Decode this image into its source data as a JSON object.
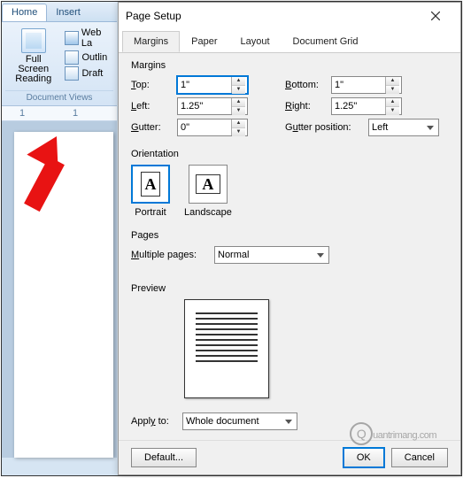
{
  "ribbon": {
    "tabs": [
      "Home",
      "Insert"
    ],
    "items": {
      "webLayout": "Web La",
      "outline": "Outlin",
      "draft": "Draft",
      "fullScreen": "Full Screen\nReading"
    },
    "group": "Document Views"
  },
  "dialog": {
    "title": "Page Setup",
    "tabs": [
      "Margins",
      "Paper",
      "Layout",
      "Document Grid"
    ],
    "margins": {
      "legend": "Margins",
      "topLabel": "Top:",
      "topValue": "1\"",
      "bottomLabel": "Bottom:",
      "bottomValue": "1\"",
      "leftLabel": "Left:",
      "leftValue": "1.25\"",
      "rightLabel": "Right:",
      "rightValue": "1.25\"",
      "gutterLabel": "Gutter:",
      "gutterValue": "0\"",
      "gutterPosLabel": "Gutter position:",
      "gutterPosValue": "Left"
    },
    "orientation": {
      "legend": "Orientation",
      "portrait": "Portrait",
      "landscape": "Landscape",
      "glyph": "A"
    },
    "pages": {
      "legend": "Pages",
      "multiLabel": "Multiple pages:",
      "multiValue": "Normal"
    },
    "preview": {
      "legend": "Preview"
    },
    "applyLabel": "Apply to:",
    "applyValue": "Whole document",
    "buttons": {
      "default": "Default...",
      "ok": "OK",
      "cancel": "Cancel"
    }
  },
  "watermark": "uantrimang.com"
}
